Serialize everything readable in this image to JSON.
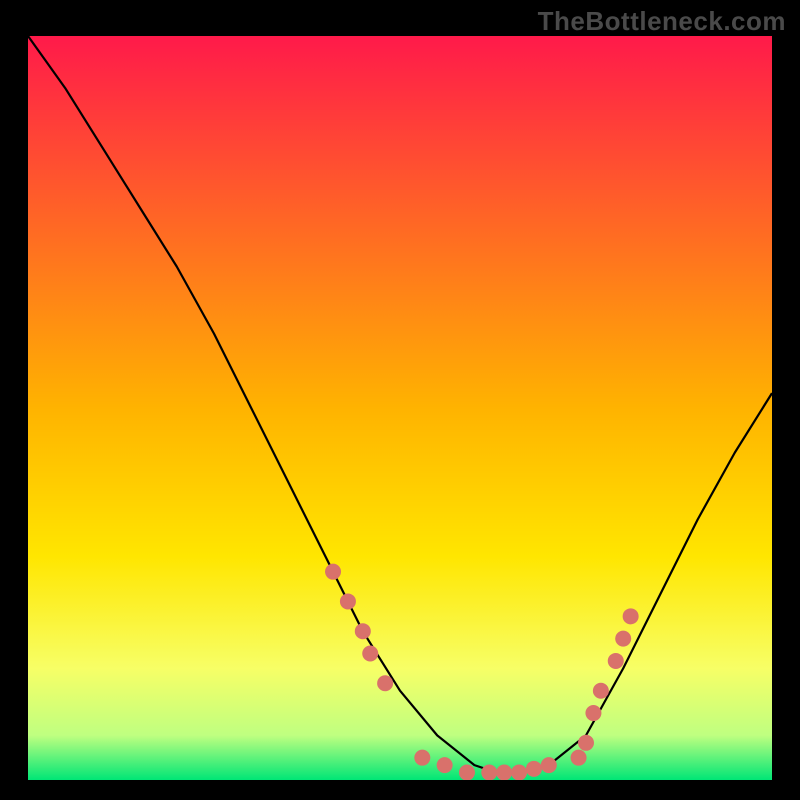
{
  "watermark": "TheBottleneck.com",
  "chart_data": {
    "type": "line",
    "title": "",
    "xlabel": "",
    "ylabel": "",
    "xlim": [
      0,
      100
    ],
    "ylim": [
      0,
      100
    ],
    "background_gradient": [
      {
        "offset": 0.0,
        "color": "#ff1a4a"
      },
      {
        "offset": 0.5,
        "color": "#ffb300"
      },
      {
        "offset": 0.7,
        "color": "#ffe600"
      },
      {
        "offset": 0.85,
        "color": "#f7ff66"
      },
      {
        "offset": 0.94,
        "color": "#bfff80"
      },
      {
        "offset": 1.0,
        "color": "#00e676"
      }
    ],
    "series": [
      {
        "name": "bottleneck-curve",
        "color": "#000000",
        "x": [
          0,
          5,
          10,
          15,
          20,
          25,
          30,
          35,
          40,
          45,
          50,
          55,
          60,
          63,
          66,
          70,
          75,
          80,
          85,
          90,
          95,
          100
        ],
        "y": [
          100,
          93,
          85,
          77,
          69,
          60,
          50,
          40,
          30,
          20,
          12,
          6,
          2,
          1,
          1,
          2,
          6,
          15,
          25,
          35,
          44,
          52
        ]
      }
    ],
    "markers": {
      "name": "highlight-dots",
      "color": "#d9716b",
      "radius": 8,
      "points": [
        {
          "x": 41,
          "y": 28
        },
        {
          "x": 43,
          "y": 24
        },
        {
          "x": 45,
          "y": 20
        },
        {
          "x": 46,
          "y": 17
        },
        {
          "x": 48,
          "y": 13
        },
        {
          "x": 53,
          "y": 3
        },
        {
          "x": 56,
          "y": 2
        },
        {
          "x": 59,
          "y": 1
        },
        {
          "x": 62,
          "y": 1
        },
        {
          "x": 64,
          "y": 1
        },
        {
          "x": 66,
          "y": 1
        },
        {
          "x": 68,
          "y": 1.5
        },
        {
          "x": 70,
          "y": 2
        },
        {
          "x": 74,
          "y": 3
        },
        {
          "x": 75,
          "y": 5
        },
        {
          "x": 76,
          "y": 9
        },
        {
          "x": 77,
          "y": 12
        },
        {
          "x": 79,
          "y": 16
        },
        {
          "x": 80,
          "y": 19
        },
        {
          "x": 81,
          "y": 22
        }
      ]
    }
  }
}
